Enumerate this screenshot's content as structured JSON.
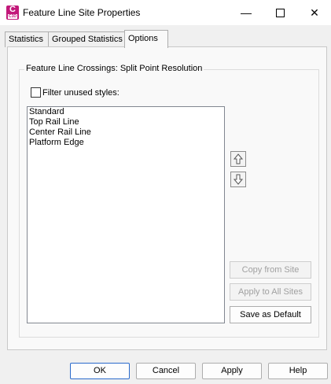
{
  "window": {
    "title": "Feature Line Site Properties",
    "icon_letter": "C",
    "icon_sub": "C3D",
    "controls": [
      "minimize-icon",
      "maximize-icon",
      "close-icon"
    ]
  },
  "tabs": [
    {
      "label": "Statistics",
      "active": false
    },
    {
      "label": "Grouped Statistics",
      "active": false
    },
    {
      "label": "Options",
      "active": true
    }
  ],
  "options": {
    "group_title": "Feature Line Crossings: Split Point Resolution",
    "filter_label": "Filter unused styles:",
    "filter_checked": false,
    "styles": [
      "Standard",
      "Top Rail Line",
      "Center Rail Line",
      "Platform Edge"
    ],
    "move_up_icon": "arrow-up-icon",
    "move_down_icon": "arrow-down-icon",
    "copy_from_site": "Copy from Site",
    "apply_to_all_sites": "Apply to All Sites",
    "save_as_default": "Save as Default"
  },
  "footer": {
    "ok": "OK",
    "cancel": "Cancel",
    "apply": "Apply",
    "help": "Help"
  },
  "colors": {
    "icon_brand": "#c2187a",
    "ok_border": "#2a6acb"
  }
}
